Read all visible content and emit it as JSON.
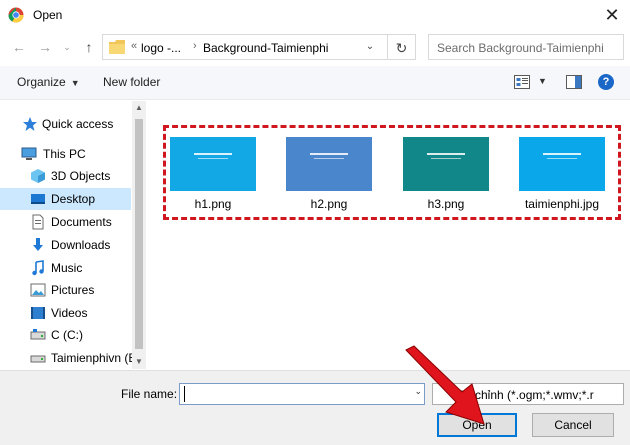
{
  "window": {
    "title": "Open",
    "close_glyph": "✕"
  },
  "address": {
    "overflow": "«",
    "crumbs": [
      "logo -...",
      "Background-Taimienphi"
    ],
    "separator": "›"
  },
  "search": {
    "placeholder": "Search Background-Taimienphi"
  },
  "toolbar": {
    "organize": "Organize",
    "new_folder": "New folder"
  },
  "sidebar": {
    "items": [
      {
        "label": "Quick access",
        "icon": "star-icon"
      },
      {
        "label": "This PC",
        "icon": "computer-icon"
      },
      {
        "label": "3D Objects",
        "icon": "cube-icon"
      },
      {
        "label": "Desktop",
        "icon": "desktop-icon",
        "selected": true
      },
      {
        "label": "Documents",
        "icon": "document-icon"
      },
      {
        "label": "Downloads",
        "icon": "download-icon"
      },
      {
        "label": "Music",
        "icon": "music-icon"
      },
      {
        "label": "Pictures",
        "icon": "pictures-icon"
      },
      {
        "label": "Videos",
        "icon": "video-icon"
      },
      {
        "label": "C (C:)",
        "icon": "drive-icon"
      },
      {
        "label": "Taimienphivn (E:",
        "icon": "drive-icon"
      }
    ]
  },
  "files": [
    {
      "name": "h1.png",
      "color": "#12a8e6"
    },
    {
      "name": "h2.png",
      "color": "#4a86cb"
    },
    {
      "name": "h3.png",
      "color": "#12878a"
    },
    {
      "name": "taimienphi.jpg",
      "color": "#0aa7ea"
    }
  ],
  "bottom": {
    "file_name_label": "File name:",
    "file_name_value": "",
    "filter_text": "ùy chỉnh (*.ogm;*.wmv;*.r",
    "open_label": "Open",
    "cancel_label": "Cancel"
  },
  "colors": {
    "accent": "#0078d7",
    "highlight": "#d0161e",
    "selected": "#cce8ff"
  }
}
